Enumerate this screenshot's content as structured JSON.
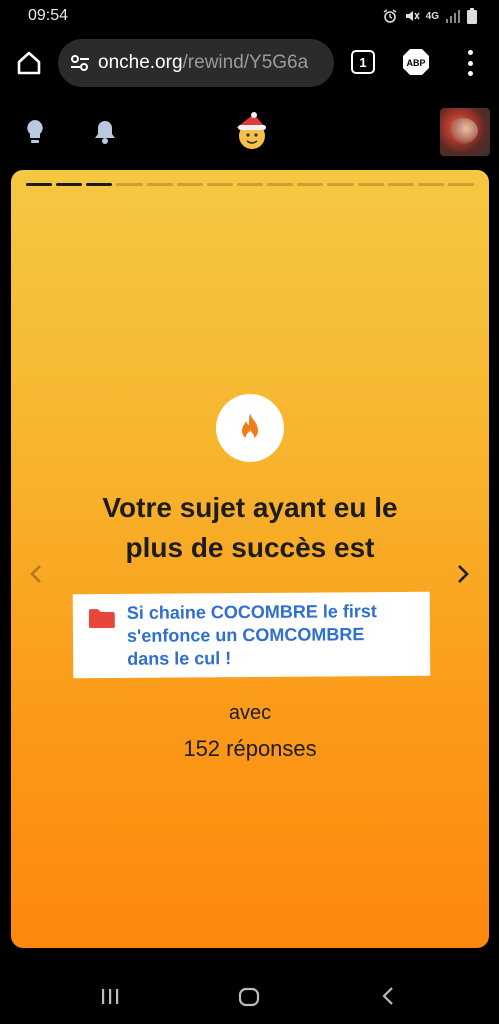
{
  "status_bar": {
    "time": "09:54",
    "network": "4G",
    "icons": [
      "alarm-icon",
      "mute-icon",
      "signal-icon",
      "battery-icon"
    ]
  },
  "browser": {
    "url_host": "onche.org",
    "url_path": "/rewind/Y5G6a",
    "tab_count": "1",
    "adblock_label": "ABP",
    "icons": [
      "home-icon",
      "site-settings-icon",
      "more-vert-icon"
    ]
  },
  "site_header": {
    "icons": [
      "bulb-icon",
      "bell-icon",
      "santa-emoji-icon"
    ],
    "avatar": "user-avatar"
  },
  "story": {
    "progress_total": 15,
    "progress_active": 3,
    "headline_line1": "Votre sujet ayant eu le",
    "headline_line2": "plus de succès est",
    "topic_line1": "Si chaine COCOMBRE le first",
    "topic_line2": "s'enfonce un COMCOMBRE",
    "topic_line3": "dans le cul !",
    "avec": "avec",
    "replies": "152 réponses",
    "colors": {
      "gradient_top": "#f5c842",
      "gradient_bottom": "#fd870c",
      "topic_link": "#2f6fd1",
      "folder": "#e8453c",
      "flame": "#f07d1a"
    }
  },
  "navbar": {
    "icons": [
      "recents-icon",
      "home-nav-icon",
      "back-icon"
    ]
  }
}
